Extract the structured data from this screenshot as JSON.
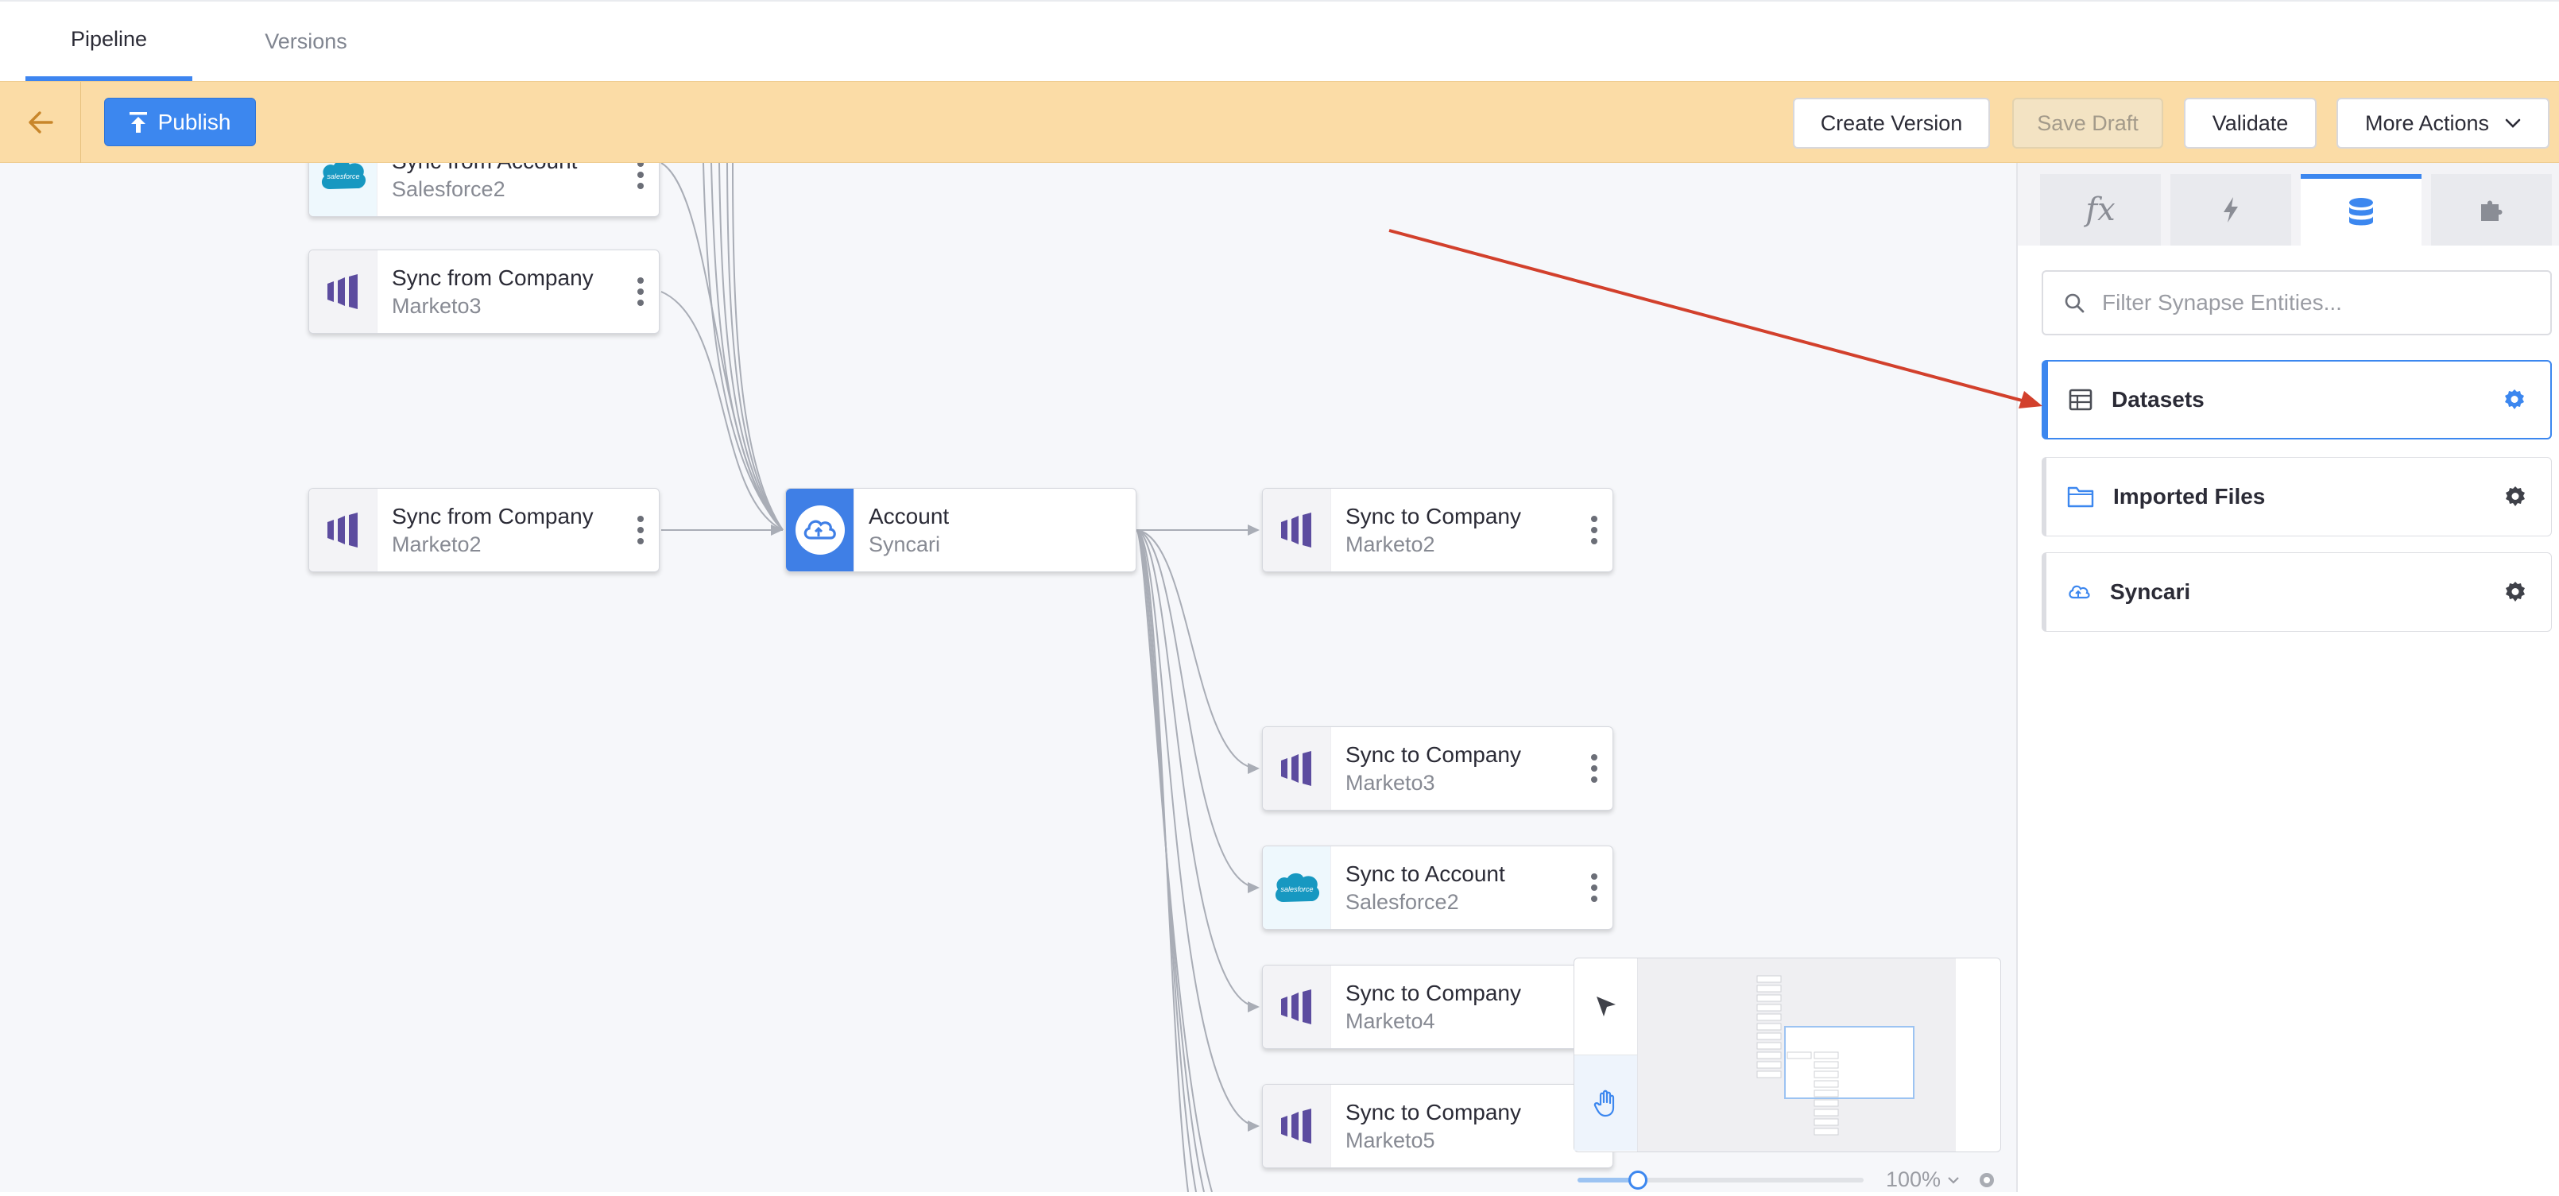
{
  "tabs": [
    {
      "label": "Pipeline",
      "active": true
    },
    {
      "label": "Versions",
      "active": false
    }
  ],
  "toolbar": {
    "publish_label": "Publish",
    "create_version_label": "Create Version",
    "save_draft_label": "Save Draft",
    "validate_label": "Validate",
    "more_actions_label": "More Actions"
  },
  "nodes": {
    "src_sf2": {
      "title": "Sync from Account",
      "subtitle": "Salesforce2"
    },
    "src_m3": {
      "title": "Sync from Company",
      "subtitle": "Marketo3"
    },
    "src_m2": {
      "title": "Sync from Company",
      "subtitle": "Marketo2"
    },
    "center": {
      "title": "Account",
      "subtitle": "Syncari"
    },
    "dst_m2": {
      "title": "Sync to Company",
      "subtitle": "Marketo2"
    },
    "dst_m3": {
      "title": "Sync to Company",
      "subtitle": "Marketo3"
    },
    "dst_sf2": {
      "title": "Sync to Account",
      "subtitle": "Salesforce2"
    },
    "dst_m4": {
      "title": "Sync to Company",
      "subtitle": "Marketo4"
    },
    "dst_m5": {
      "title": "Sync to Company",
      "subtitle": "Marketo5"
    }
  },
  "minimap": {
    "zoom_label": "100%",
    "zoom_fraction": 0.21
  },
  "panel": {
    "tabs": [
      {
        "icon": "function-icon",
        "label": "fx",
        "active": false
      },
      {
        "icon": "bolt-icon",
        "active": false
      },
      {
        "icon": "database-icon",
        "active": true
      },
      {
        "icon": "puzzle-icon",
        "active": false
      }
    ],
    "search_placeholder": "Filter Synapse Entities...",
    "entities": [
      {
        "label": "Datasets",
        "icon": "table-icon",
        "active": true
      },
      {
        "label": "Imported Files",
        "icon": "folder-icon",
        "active": false
      },
      {
        "label": "Syncari",
        "icon": "cloud-icon",
        "active": false
      }
    ]
  },
  "colors": {
    "accent": "#3c87ef",
    "toolbar_bg": "#fbdca6",
    "marketo": "#5c4c9f",
    "salesforce": "#1798c1",
    "annotation": "#d2402c"
  }
}
